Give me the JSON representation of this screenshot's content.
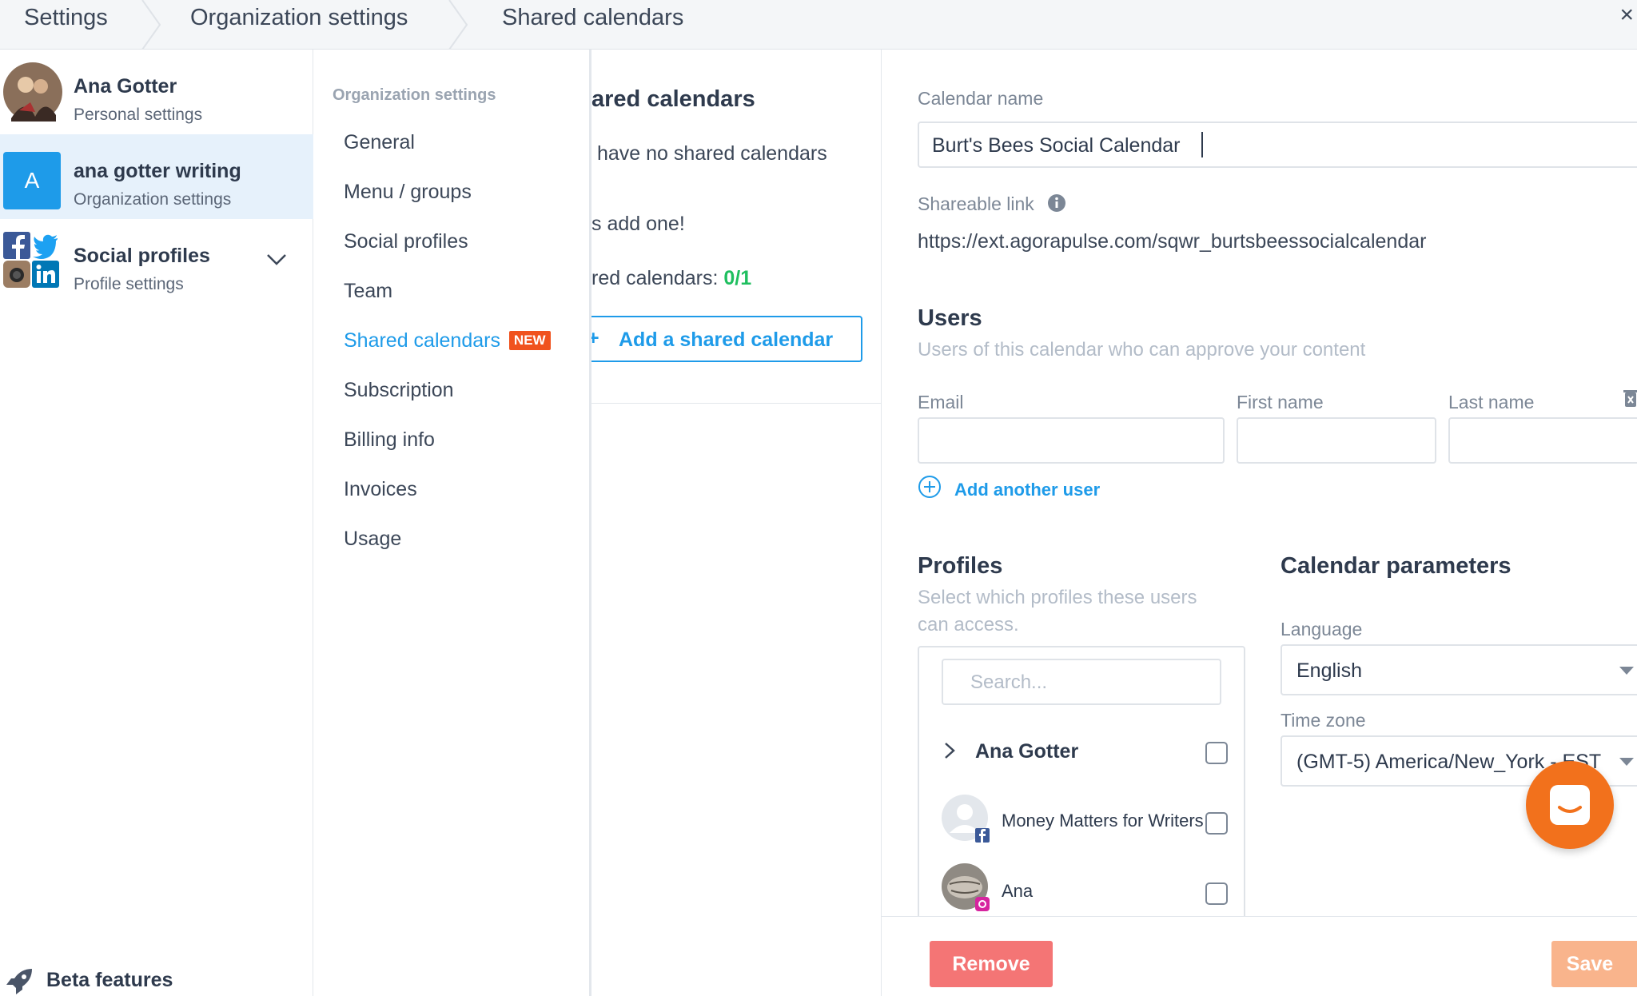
{
  "breadcrumb": {
    "items": [
      "Settings",
      "Organization settings",
      "Shared calendars"
    ]
  },
  "accounts": {
    "personal": {
      "name": "Ana Gotter",
      "sub": "Personal settings"
    },
    "organization": {
      "initial": "A",
      "name": "ana gotter writing",
      "sub": "Organization settings"
    },
    "social": {
      "name": "Social profiles",
      "sub": "Profile settings"
    }
  },
  "beta": {
    "label": "Beta features"
  },
  "nav": {
    "section_title": "Organization settings",
    "items": [
      "General",
      "Menu / groups",
      "Social profiles",
      "Team",
      "Shared calendars",
      "Subscription",
      "Billing info",
      "Invoices",
      "Usage"
    ],
    "active_index": 4,
    "new_badge": "NEW"
  },
  "middle": {
    "title": "ared calendars",
    "empty_text": "have no shared calendars",
    "prompt": "s add one!",
    "count_label": "red calendars:",
    "count_value": "0/1",
    "add_button": "Add a shared calendar"
  },
  "form": {
    "calendar_name_label": "Calendar name",
    "calendar_name_value": "Burt's Bees Social Calendar",
    "shareable_link_label": "Shareable link",
    "shareable_link_value": "https://ext.agorapulse.com/sqwr_burtsbeessocialcalendar",
    "users_title": "Users",
    "users_subtitle": "Users of this calendar who can approve your content",
    "email_label": "Email",
    "first_name_label": "First name",
    "last_name_label": "Last name",
    "add_user_label": "Add another user",
    "profiles_title": "Profiles",
    "profiles_subtitle_1": "Select which profiles these users",
    "profiles_subtitle_2": "can access.",
    "search_placeholder": "Search...",
    "profile_group": "Ana Gotter",
    "profiles": [
      "Money Matters for Writers",
      "Ana"
    ],
    "params_title": "Calendar parameters",
    "language_label": "Language",
    "language_value": "English",
    "timezone_label": "Time zone",
    "timezone_value": "(GMT-5) America/New_York - EST"
  },
  "footer": {
    "remove_label": "Remove",
    "save_label": "Save"
  },
  "colors": {
    "accent": "#1e9be9",
    "new_badge": "#f0521e",
    "count_green": "#1fbf5f",
    "remove_button": "#f47575",
    "save_button": "#f9b48c",
    "chat_button": "#f2711c"
  }
}
